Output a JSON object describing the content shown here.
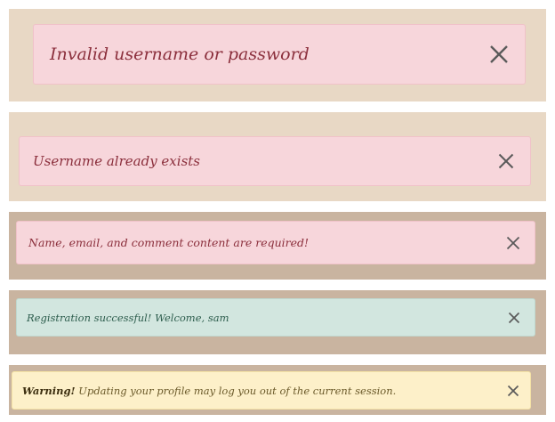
{
  "colors": {
    "panel_light": "#e8d8c5",
    "panel_dark": "#c9b4a0",
    "danger_bg": "#f7d6db",
    "danger_border": "#f0c2c9",
    "danger_text": "#8b2f3c",
    "success_bg": "#d2e6df",
    "success_border": "#bfd8cf",
    "success_text": "#2e5e4e",
    "warning_bg": "#fdf0c9",
    "warning_border": "#f5e2a5",
    "warning_text": "#6b5a2a",
    "close_icon": "#5a5a5a"
  },
  "alerts": [
    {
      "type": "danger",
      "message": "Invalid username or password",
      "close_icon": "close-icon"
    },
    {
      "type": "danger",
      "message": "Username already exists",
      "close_icon": "close-icon"
    },
    {
      "type": "danger",
      "message": "Name, email, and comment content are required!",
      "close_icon": "close-icon"
    },
    {
      "type": "success",
      "message": "Registration successful! Welcome, sam",
      "close_icon": "close-icon"
    },
    {
      "type": "warning",
      "strong": "Warning!",
      "message": " Updating your profile may log you out of the current session.",
      "close_icon": "close-icon"
    }
  ]
}
